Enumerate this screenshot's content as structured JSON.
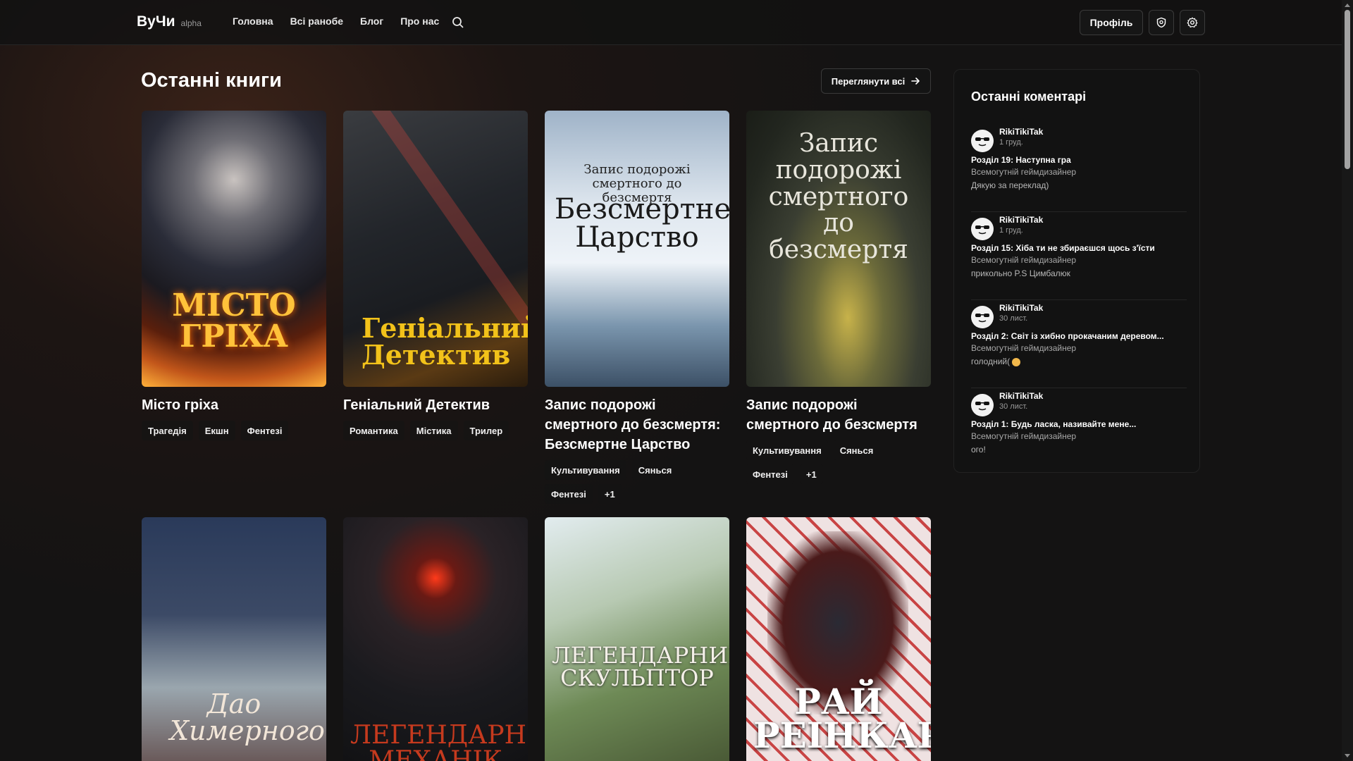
{
  "header": {
    "logo": "ВуЧи",
    "logo_badge": "alpha",
    "nav": [
      "Головна",
      "Всі ранобе",
      "Блог",
      "Про нас"
    ],
    "profile_label": "Профіль",
    "icons": [
      "search-icon",
      "shield-icon",
      "gear-icon"
    ]
  },
  "main": {
    "section_title": "Останні книги",
    "view_all_label": "Переглянути всі",
    "books": [
      {
        "title": "Місто гріха",
        "cover_text": "МІСТО ГРІХА",
        "tags": [
          "Трагедія",
          "Екшн",
          "Фентезі"
        ]
      },
      {
        "title": "Геніальний Детектив",
        "cover_text": "Геніальний Детектив",
        "tags": [
          "Романтика",
          "Містика",
          "Трилер"
        ]
      },
      {
        "title": "Запис подорожі смертного до безсмертя: Безсмертне Царство",
        "cover_text_small": "Запис подорожі смертного до безсмертя",
        "cover_text": "Безсмертне Царство",
        "tags": [
          "Культивування",
          "Сянься",
          "Фентезі",
          "+1"
        ]
      },
      {
        "title": "Запис подорожі смертного до безсмертя",
        "cover_text": "Запис подорожі смертного до безсмертя",
        "tags": [
          "Культивування",
          "Сянься",
          "Фентезі",
          "+1"
        ]
      },
      {
        "cover_text": "Дао Химерного"
      },
      {
        "cover_text": "ЛЕГЕНДАРНИЙ МЕХАНІК"
      },
      {
        "cover_text": "ЛЕГЕНДАРНИЙ СКУЛЬПТОР"
      },
      {
        "cover_text": "РАЙ РЕІНКАРНАЦІЇ"
      }
    ]
  },
  "comments": {
    "title": "Останні коментарі",
    "items": [
      {
        "author": "RikiTikiTak",
        "date": "1 груд.",
        "chapter": "Розділ 19: Наступна гра",
        "book": "Всемогутній геймдизайнер",
        "text": "Дякую за переклад)"
      },
      {
        "author": "RikiTikiTak",
        "date": "1 груд.",
        "chapter": "Розділ 15: Хіба ти не збираєшся щось з'їсти",
        "book": "Всемогутній геймдизайнер",
        "text": "прикольно P.S Цимбалюк"
      },
      {
        "author": "RikiTikiTak",
        "date": "30 лист.",
        "chapter": "Розділ 2: Світ із хибно прокачаним деревом...",
        "book": "Всемогутній геймдизайнер",
        "text": "голодний("
      },
      {
        "author": "RikiTikiTak",
        "date": "30 лист.",
        "chapter": "Розділ 1: Будь ласка, називайте мене...",
        "book": "Всемогутній геймдизайнер",
        "text": "ого!"
      }
    ]
  }
}
